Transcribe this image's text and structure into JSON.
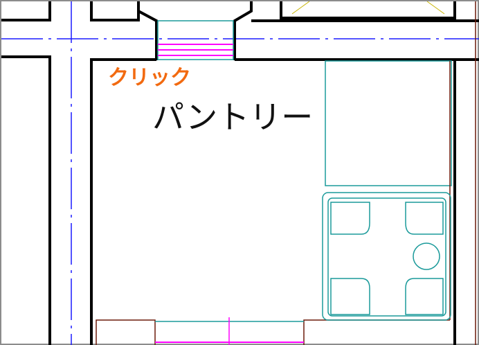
{
  "labels": {
    "click": "クリック",
    "room": "パントリー"
  },
  "colors": {
    "wall": "#000000",
    "center_line": "#1a1aff",
    "window_glass": "#ff00ff",
    "fixture": "#1a9a9a",
    "cabinet": "#6b1a0a",
    "accent_text": "#f26a10",
    "frame_border": "#8c8c8c"
  },
  "icons": {
    "stove": "stove-top-icon",
    "window": "window-icon",
    "door": "door-icon"
  }
}
